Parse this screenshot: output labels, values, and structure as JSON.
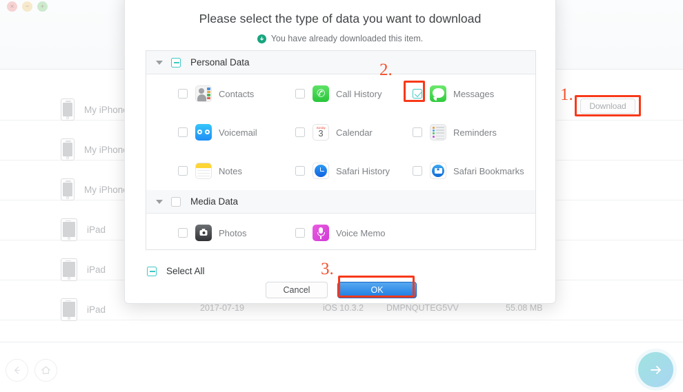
{
  "window": {
    "traffic_lights": [
      {
        "name": "close",
        "glyph": "×",
        "color": "#f3a0a0"
      },
      {
        "name": "minimize",
        "glyph": "−",
        "color": "#f2d492"
      },
      {
        "name": "maximize",
        "glyph": "+",
        "color": "#97d694"
      }
    ]
  },
  "background": {
    "devices": [
      {
        "label": "My iPhone",
        "type": "iphone"
      },
      {
        "label": "My iPhone",
        "type": "iphone"
      },
      {
        "label": "My iPhone",
        "type": "iphone"
      },
      {
        "label": "iPad",
        "type": "ipad"
      },
      {
        "label": "iPad",
        "type": "ipad"
      },
      {
        "label": "iPad",
        "type": "ipad"
      }
    ],
    "partial_row": {
      "date": "2017-07-19",
      "ios_version": "iOS 10.3.2",
      "serial": "DMPNQUTEG5VV",
      "size": "55.08 MB"
    },
    "download_button": "Download"
  },
  "dialog": {
    "title": "Please select the type of data you want to download",
    "subtitle": "You have already downloaded this item.",
    "subtitle_icon": "download-circle-icon",
    "groups": [
      {
        "label": "Personal Data",
        "checkbox_state": "indeterminate",
        "expanded": true,
        "rows": [
          [
            {
              "label": "Contacts",
              "icon": "contacts-icon",
              "checked": false
            },
            {
              "label": "Call History",
              "icon": "call-history-icon",
              "checked": false
            },
            {
              "label": "Messages",
              "icon": "messages-icon",
              "checked": true
            }
          ],
          [
            {
              "label": "Voicemail",
              "icon": "voicemail-icon",
              "checked": false
            },
            {
              "label": "Calendar",
              "icon": "calendar-icon",
              "checked": false
            },
            {
              "label": "Reminders",
              "icon": "reminders-icon",
              "checked": false
            }
          ],
          [
            {
              "label": "Notes",
              "icon": "notes-icon",
              "checked": false
            },
            {
              "label": "Safari History",
              "icon": "safari-history-icon",
              "checked": false
            },
            {
              "label": "Safari Bookmarks",
              "icon": "safari-bookmarks-icon",
              "checked": false
            }
          ]
        ]
      },
      {
        "label": "Media Data",
        "checkbox_state": "unchecked",
        "expanded": true,
        "rows": [
          [
            {
              "label": "Photos",
              "icon": "photos-icon",
              "checked": false
            },
            {
              "label": "Voice Memo",
              "icon": "voice-memo-icon",
              "checked": false
            }
          ]
        ]
      }
    ],
    "calendar_icon": {
      "weekday": "Sunday",
      "day": "3"
    },
    "select_all": {
      "label": "Select All",
      "state": "indeterminate"
    },
    "cancel_label": "Cancel",
    "ok_label": "OK"
  },
  "annotations": [
    {
      "number": "1.",
      "target": "download-button"
    },
    {
      "number": "2.",
      "target": "messages-checkbox"
    },
    {
      "number": "3.",
      "target": "ok-button"
    }
  ],
  "footer_nav": {
    "back_icon": "arrow-left-icon",
    "home_icon": "home-icon",
    "next_icon": "arrow-right-icon"
  },
  "colors": {
    "accent_teal": "#3ec8c4",
    "primary_blue": "#1a7ae2",
    "annotation_red": "#f8391a",
    "annotation_orange": "#f4502c",
    "download_green": "#18a67f"
  }
}
